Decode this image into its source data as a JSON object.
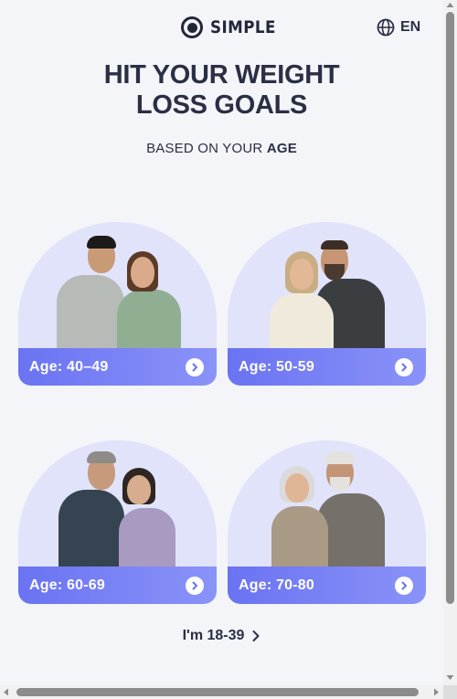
{
  "brand": {
    "name": "SIMPLE"
  },
  "language": {
    "code": "EN",
    "icon": "globe-icon"
  },
  "headline": {
    "line1": "HIT YOUR WEIGHT",
    "line2": "LOSS GOALS"
  },
  "subline": {
    "prefix": "BASED ON YOUR ",
    "emphasis": "AGE"
  },
  "cards": [
    {
      "label": "Age: 40–49",
      "icon": "chevron-right-circle-icon"
    },
    {
      "label": "Age: 50-59",
      "icon": "chevron-right-circle-icon"
    },
    {
      "label": "Age: 60-69",
      "icon": "chevron-right-circle-icon"
    },
    {
      "label": "Age: 70-80",
      "icon": "chevron-right-circle-icon"
    }
  ],
  "younger_link": {
    "label": "I'm 18-39",
    "icon": "chevron-right-icon"
  },
  "colors": {
    "background": "#f3f5f8",
    "text": "#2b2f45",
    "card_arch": "#e0e3fa",
    "card_bar_start": "#6a73f2",
    "card_bar_end": "#8a93f8"
  }
}
